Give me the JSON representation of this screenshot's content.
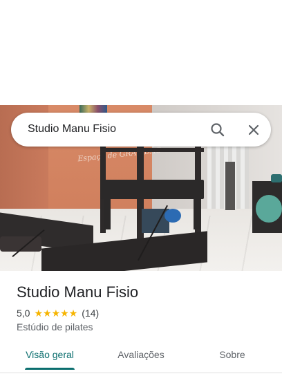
{
  "search": {
    "query": "Studio Manu Fisio"
  },
  "photo": {
    "wall_text": "Espaço de GRATIDÃO"
  },
  "place": {
    "name": "Studio Manu Fisio",
    "rating": "5,0",
    "stars": [
      "★",
      "★",
      "★",
      "★",
      "★"
    ],
    "review_count": "(14)",
    "category": "Estúdio de pilates"
  },
  "tabs": [
    {
      "label": "Visão geral",
      "selected": true
    },
    {
      "label": "Avaliações",
      "selected": false
    },
    {
      "label": "Sobre",
      "selected": false
    }
  ],
  "colors": {
    "accent": "#0b6e6e",
    "star": "#f6b400",
    "text_primary": "#202124",
    "text_secondary": "#5f6368"
  },
  "icons": {
    "search": "search-icon",
    "close": "close-icon",
    "star": "star-icon"
  }
}
